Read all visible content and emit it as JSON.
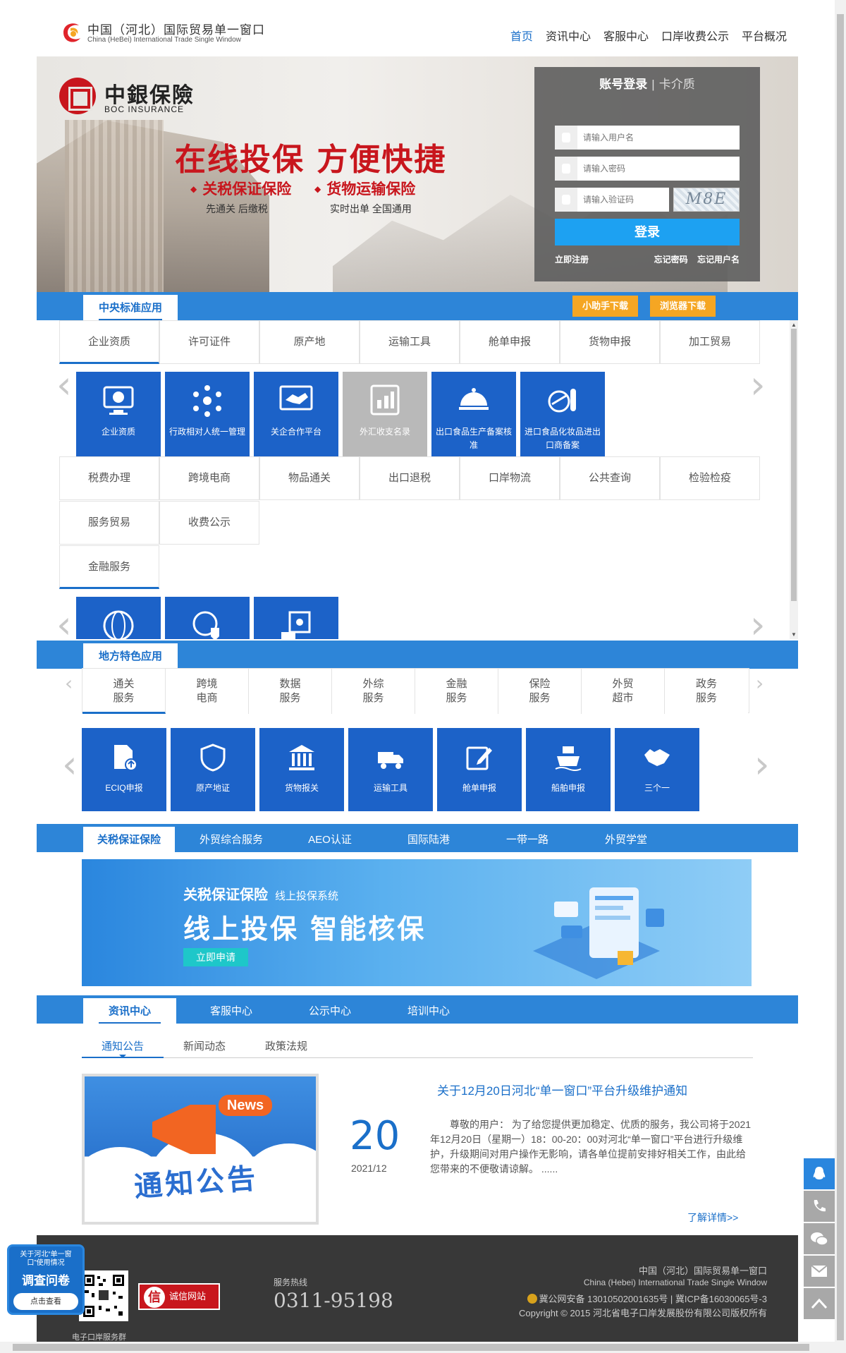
{
  "header": {
    "logo_cn": "中国（河北）国际贸易单一窗口",
    "logo_en": "China (HeBei) International Trade Single Window",
    "nav": [
      "首页",
      "资讯中心",
      "客服中心",
      "口岸收费公示",
      "平台概况"
    ]
  },
  "banner": {
    "brand_cn": "中銀保險",
    "brand_en": "BOC INSURANCE",
    "slogan": "在线投保  方便快捷",
    "product1": "关税保证保险",
    "product1_sub": "先通关 后缴税",
    "product2": "货物运输保险",
    "product2_sub": "实时出单 全国通用"
  },
  "login": {
    "tab_account": "账号登录",
    "tab_card": "卡介质",
    "username_placeholder": "请输入用户名",
    "password_placeholder": "请输入密码",
    "captcha_placeholder": "请输入验证码",
    "captcha_text": "M8E",
    "login_button": "登录",
    "register": "立即注册",
    "forgot_password": "忘记密码",
    "forgot_username": "忘记用户名"
  },
  "central": {
    "title": "中央标准应用",
    "assistant_button": "小助手下载",
    "browser_button": "浏览器下载",
    "tabs_row1": [
      "企业资质",
      "许可证件",
      "原产地",
      "运输工具",
      "舱单申报",
      "货物申报",
      "加工贸易"
    ],
    "tiles": [
      "企业资质",
      "行政相对人统一管理",
      "关企合作平台",
      "外汇收支名录",
      "出口食品生产备案核准",
      "进口食品化妆品进出口商备案"
    ],
    "tabs_row2": [
      "税费办理",
      "跨境电商",
      "物品通关",
      "出口退税",
      "口岸物流",
      "公共查询",
      "检验检疫"
    ],
    "tabs_row3": [
      "服务贸易",
      "收费公示"
    ],
    "tabs_row4": [
      "金融服务"
    ]
  },
  "local": {
    "title": "地方特色应用",
    "tabs": [
      [
        "通关",
        "服务"
      ],
      [
        "跨境",
        "电商"
      ],
      [
        "数据",
        "服务"
      ],
      [
        "外综",
        "服务"
      ],
      [
        "金融",
        "服务"
      ],
      [
        "保险",
        "服务"
      ],
      [
        "外贸",
        "超市"
      ],
      [
        "政务",
        "服务"
      ]
    ],
    "tiles": [
      "ECIQ申报",
      "原产地证",
      "货物报关",
      "运输工具",
      "舱单申报",
      "船舶申报",
      "三个一"
    ]
  },
  "bonded_bar": {
    "tabs": [
      "关税保证保险",
      "外贸综合服务",
      "AEO认证",
      "国际陆港",
      "一带一路",
      "外贸学堂"
    ],
    "promo_title": "关税保证保险",
    "promo_sub": "线上投保系统",
    "promo_slogan": "线上投保  智能核保",
    "promo_button": "立即申请"
  },
  "news": {
    "tabs": [
      "资讯中心",
      "客服中心",
      "公示中心",
      "培训中心"
    ],
    "subtabs": [
      "通知公告",
      "新闻动态",
      "政策法规"
    ],
    "image_badge": "News",
    "image_title": "通知公告",
    "day": "20",
    "year_month": "2021/12",
    "title": "关于12月20日河北“单一窗口”平台升级维护通知",
    "text": "尊敬的用户： 为了给您提供更加稳定、优质的服务，我公司将于2021年12月20日（星期一）18：00-20：00对河北“单一窗口”平台进行升级维护，升级期间对用户操作无影响，请各单位提前安排好相关工作，由此给您带来的不便敬请谅解。 ......",
    "more": "了解详情>>"
  },
  "footer": {
    "qr_label": "电子口岸服务群",
    "credit": "诚信网站",
    "credit_icon": "信",
    "hotline_label": "服务热线",
    "hotline": "0311-95198",
    "right1": "中国（河北）国际贸易单一窗口",
    "right2": "China (Hebei) International Trade Single Window",
    "right3": "冀公网安备 13010502001635号 | 冀ICP备16030065号-3",
    "right4": "Copyright © 2015 河北省电子口岸发展股份有限公司版权所有"
  },
  "survey": {
    "line1": "关于河北“单一窗口”使用情况",
    "line2": "调查问卷",
    "button": "点击查看"
  },
  "colors": {
    "primary": "#2d85d8",
    "tile": "#1c62c8",
    "orange": "#f5a623",
    "brand_red": "#c8161d",
    "footer": "#383838"
  }
}
